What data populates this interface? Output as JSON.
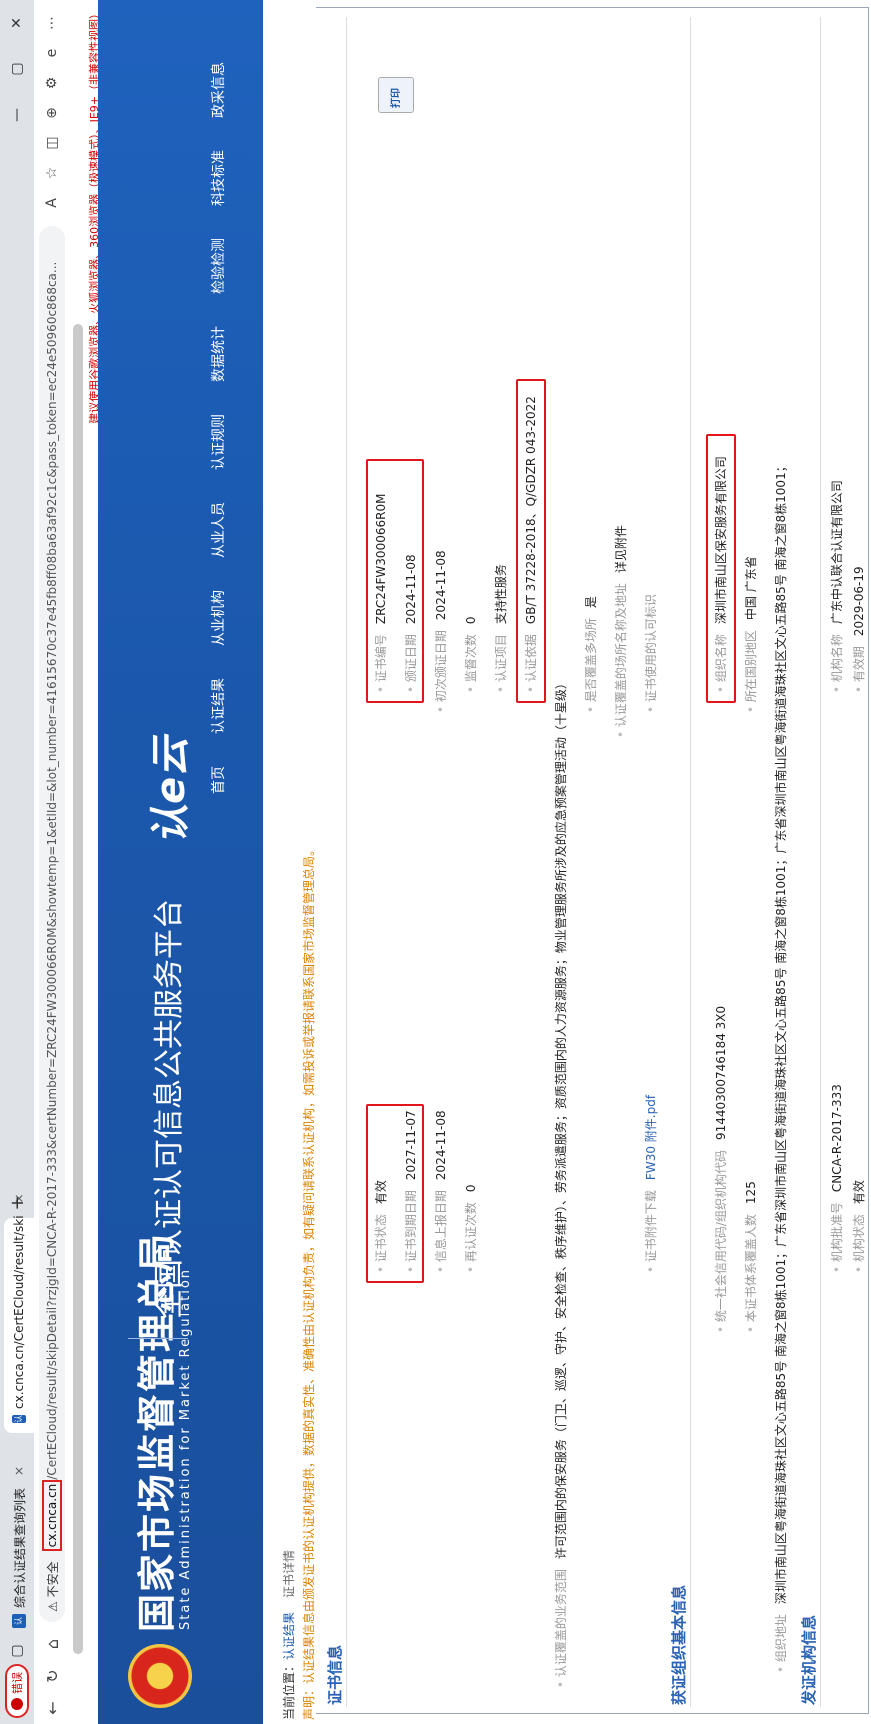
{
  "browser": {
    "profile_label": "错误",
    "tabs": [
      {
        "title": "综合认证结果查询列表",
        "close": ""
      },
      {
        "title": "cx.cnca.cn/CertECloud/result/ski",
        "close": "×"
      }
    ],
    "new_tab": "+",
    "insecure_label": "不安全",
    "url_domain": "cx.cnca.cn",
    "url_path": "/CertECloud/result/skipDetail?rzjgId=CNCA-R-2017-333&certNumber=ZRC24FW300066R0M&showtemp=1&etlId=&lot_number=41615670c37e45fb8ff08ba63af92c1c&pass_token=ec24e50960c868ca...",
    "window_controls": [
      "—",
      "▢",
      "✕"
    ]
  },
  "page": {
    "browser_notice": "建议使用谷歌浏览器、火狐浏览器、360浏览器（极速模式）、IE9+（非兼容性视图）",
    "header": {
      "title_cn": "国家市场监督管理总局",
      "title_en": "State Administration  for  Market Regulation",
      "platform_title": "全国认证认可信息公共服务平台",
      "logo_mark": "认e云",
      "menu": [
        "首页",
        "认证结果",
        "从业机构",
        "从业人员",
        "认证规则",
        "数据统计",
        "检验检测",
        "科技标准",
        "政采信息"
      ]
    },
    "breadcrumb": {
      "prefix": "当前位置：",
      "link": "认证结果",
      "current": "证书详情"
    },
    "disclaimer": "声明：认证结果信息由颁发证书的认证机构提供，数据的真实性、准确性由认证机构负责，如有疑问请联系认证机构，如需投诉或举报请联系国家市场监督管理总局。",
    "print_label": "打印",
    "cert_section": {
      "title": "证书信息",
      "left": [
        {
          "k": "证书编号",
          "v": "ZRC24FW300066R0M"
        },
        {
          "k": "颁证日期",
          "v": "2024-11-08"
        },
        {
          "k": "初次颁证日期",
          "v": "2024-11-08"
        },
        {
          "k": "监督次数",
          "v": "0"
        },
        {
          "k": "认证项目",
          "v": "支持性服务"
        },
        {
          "k": "认证依据",
          "v": "GB/T 37228-2018、Q/GDZR 043-2022"
        },
        {
          "k": "认证覆盖的业务范围",
          "v": "许可范围内的保安服务（门卫、巡逻、守护、安全检查、秩序维护）、劳务派遣服务；资质范围内的人力资源服务；物业管理服务所涉及的应急预案管理活动（十星级）"
        },
        {
          "k": "是否覆盖多场所",
          "v": "是"
        },
        {
          "k": "认证覆盖的场所名称及地址",
          "v": "详见附件"
        },
        {
          "k": "证书使用的认可标识",
          "v": ""
        }
      ],
      "right": [
        {
          "k": "证书状态",
          "v": "有效"
        },
        {
          "k": "证书到期日期",
          "v": "2027-11-07"
        },
        {
          "k": "信息上报日期",
          "v": "2024-11-08"
        },
        {
          "k": "再认证次数",
          "v": "0"
        },
        {
          "k": "证书附件下载",
          "v": "FW30 附件.pdf"
        }
      ]
    },
    "org_section": {
      "title": "获证组织基本信息",
      "left": [
        {
          "k": "组织名称",
          "v": "深圳市南山区保安服务有限公司"
        },
        {
          "k": "所在国别地区",
          "v": "中国 广东省"
        },
        {
          "k": "组织地址",
          "v": "深圳市南山区粤海街道海珠社区文心五路85号 南海之窗8栋1001；广东省深圳市南山区粤海街道海珠社区文心五路85号 南海之窗8栋1001；广东省深圳市南山区粤海街道海珠社区文心五路85号 南海之窗8栋1001；"
        }
      ],
      "right": [
        {
          "k": "统一社会信用代码/组织机构代码",
          "v": "91440300746184 3X0"
        },
        {
          "k": "本证书体系覆盖人数",
          "v": "125"
        }
      ]
    },
    "issuer_section": {
      "title": "发证机构信息",
      "left": [
        {
          "k": "机构名称",
          "v": "广东中认联合认证有限公司"
        },
        {
          "k": "有效期",
          "v": "2029-06-19"
        }
      ],
      "right": [
        {
          "k": "机构批准号",
          "v": "CNCA-R-2017-333"
        },
        {
          "k": "机构状态",
          "v": "有效"
        }
      ]
    }
  }
}
